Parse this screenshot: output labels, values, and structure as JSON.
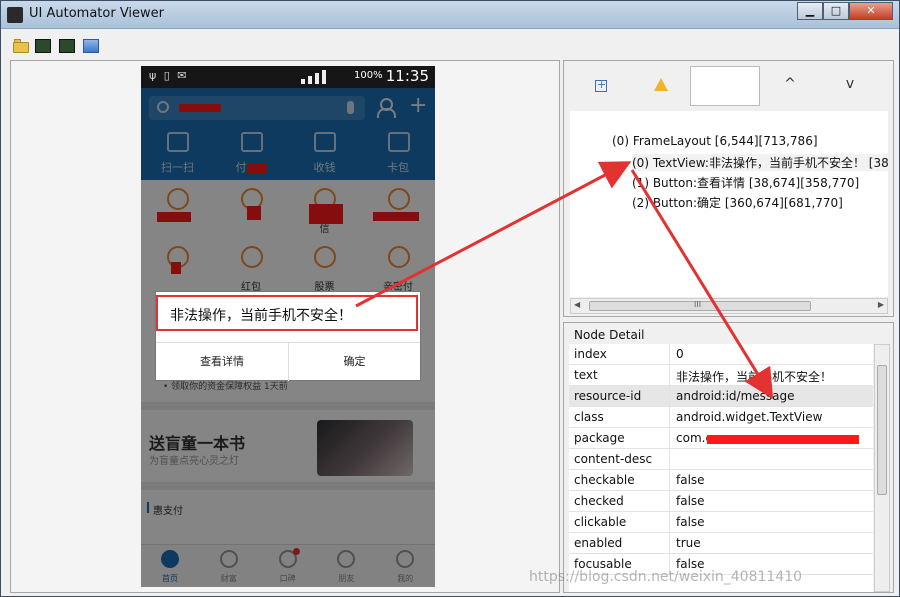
{
  "window": {
    "title": "UI Automator Viewer",
    "minimize": "▁",
    "maximize": "□",
    "close": "✕"
  },
  "phone": {
    "status": {
      "left_icons": "ψ ▯ ✉",
      "battery": "100%",
      "time": "11:35"
    },
    "quick_actions": [
      "扫一扫",
      "付",
      "收钱",
      "卡包"
    ],
    "grid_row2": [
      "",
      "",
      "信",
      ""
    ],
    "grid_row3": [
      "",
      "红包",
      "股票",
      "亲密付"
    ],
    "security_text": "• 领取你的资金保障权益   1天前",
    "promo_title": "送盲童一本书",
    "promo_subtitle": "为盲童点亮心灵之灯",
    "section_label": "惠支付",
    "bottom_nav": [
      "首页",
      "财富",
      "口碑",
      "朋友",
      "我的"
    ],
    "dialog": {
      "message": "非法操作，当前手机不安全！",
      "btn_details": "查看详情",
      "btn_ok": "确定"
    }
  },
  "hierarchy": {
    "nodes": [
      {
        "label": "(0) FrameLayout [6,544][713,786]"
      },
      {
        "label": "(0) TextView:非法操作，当前手机不安全！ [38,"
      },
      {
        "label": "(1) Button:查看详情 [38,674][358,770]"
      },
      {
        "label": "(2) Button:确定 [360,674][681,770]"
      }
    ],
    "up": "^",
    "down": "v",
    "scroll_thumb": "III"
  },
  "node_detail": {
    "title": "Node Detail",
    "rows": [
      {
        "key": "index",
        "value": "0"
      },
      {
        "key": "text",
        "value": "非法操作，当前手机不安全！"
      },
      {
        "key": "resource-id",
        "value": "android:id/message"
      },
      {
        "key": "class",
        "value": "android.widget.TextView"
      },
      {
        "key": "package",
        "value": "com.e"
      },
      {
        "key": "content-desc",
        "value": ""
      },
      {
        "key": "checkable",
        "value": "false"
      },
      {
        "key": "checked",
        "value": "false"
      },
      {
        "key": "clickable",
        "value": "false"
      },
      {
        "key": "enabled",
        "value": "true"
      },
      {
        "key": "focusable",
        "value": "false"
      }
    ]
  },
  "watermark": "https://blog.csdn.net/weixin_40811410",
  "colors": {
    "accent_blue": "#1a6fb5",
    "annotation_red": "#e23232",
    "redact_red": "#ff1a1a"
  }
}
